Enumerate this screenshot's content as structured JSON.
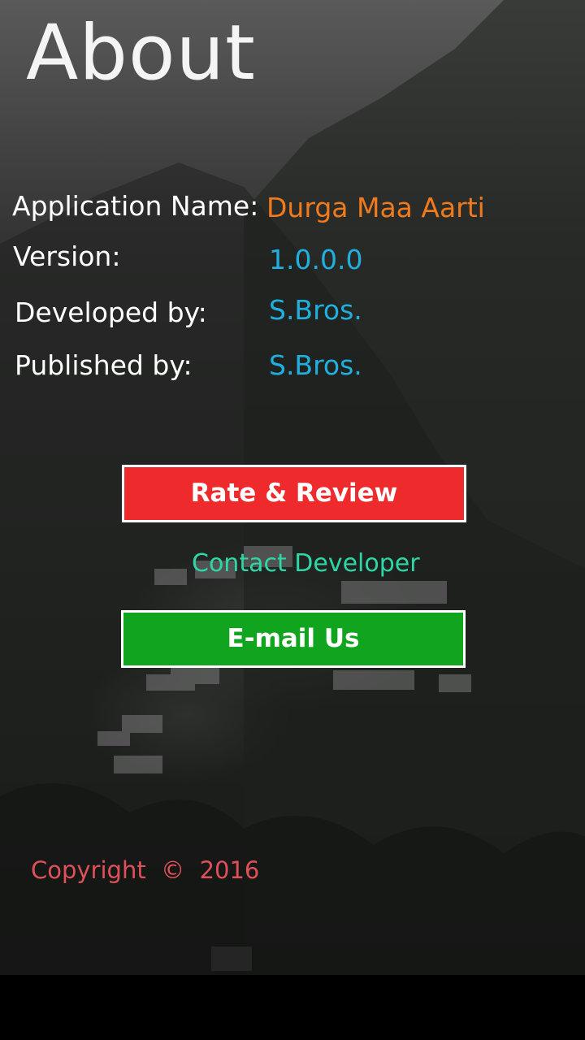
{
  "page": {
    "title": "About"
  },
  "info": {
    "app_name_label": "Application Name:",
    "app_name_value": "Durga Maa Aarti",
    "version_label": "Version:",
    "version_value": "1.0.0.0",
    "developed_label": "Developed by:",
    "developed_value": "S.Bros.",
    "published_label": "Published by:",
    "published_value": "S.Bros."
  },
  "actions": {
    "rate_label": "Rate & Review",
    "contact_label": "Contact Developer",
    "email_label": "E-mail Us"
  },
  "footer": {
    "copyright": "Copyright  ©  2016"
  },
  "colors": {
    "app_name": "#f07a1c",
    "value_blue": "#1fb0e0",
    "rate_button": "#ee2a2c",
    "email_button": "#11a41f",
    "contact_link": "#2ed8a6",
    "copyright": "#e0505a"
  }
}
